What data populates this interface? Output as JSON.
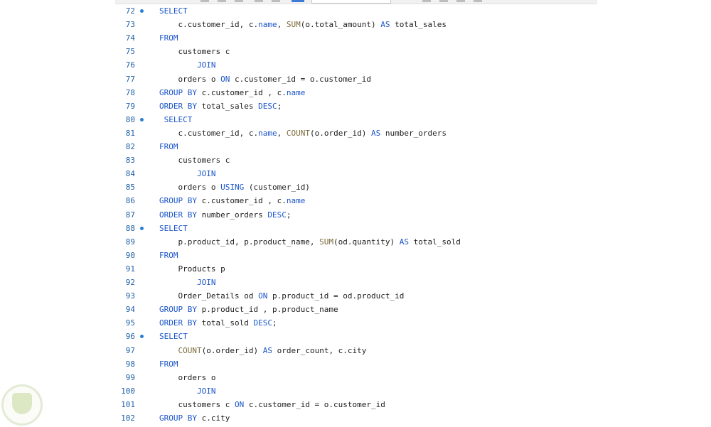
{
  "editor": {
    "lines": [
      {
        "num": "72",
        "fold": true,
        "tokens": [
          {
            "t": "SELECT",
            "k": "kw"
          }
        ]
      },
      {
        "num": "73",
        "fold": false,
        "tokens": [
          {
            "t": "    c.customer_id, c.",
            "k": "tx"
          },
          {
            "t": "name",
            "k": "kw"
          },
          {
            "t": ", ",
            "k": "tx"
          },
          {
            "t": "SUM",
            "k": "fn"
          },
          {
            "t": "(o.total_amount) ",
            "k": "tx"
          },
          {
            "t": "AS",
            "k": "kw"
          },
          {
            "t": " total_sales",
            "k": "tx"
          }
        ]
      },
      {
        "num": "74",
        "fold": false,
        "tokens": [
          {
            "t": "FROM",
            "k": "kw"
          }
        ]
      },
      {
        "num": "75",
        "fold": false,
        "tokens": [
          {
            "t": "    customers c",
            "k": "tx"
          }
        ]
      },
      {
        "num": "76",
        "fold": false,
        "tokens": [
          {
            "t": "        ",
            "k": "tx"
          },
          {
            "t": "JOIN",
            "k": "kw"
          }
        ]
      },
      {
        "num": "77",
        "fold": false,
        "tokens": [
          {
            "t": "    orders o ",
            "k": "tx"
          },
          {
            "t": "ON",
            "k": "kw"
          },
          {
            "t": " c.customer_id = o.customer_id",
            "k": "tx"
          }
        ]
      },
      {
        "num": "78",
        "fold": false,
        "tokens": [
          {
            "t": "GROUP BY",
            "k": "kw"
          },
          {
            "t": " c.customer_id , c.",
            "k": "tx"
          },
          {
            "t": "name",
            "k": "kw"
          }
        ]
      },
      {
        "num": "79",
        "fold": false,
        "tokens": [
          {
            "t": "ORDER BY",
            "k": "kw"
          },
          {
            "t": " total_sales ",
            "k": "tx"
          },
          {
            "t": "DESC",
            "k": "kw"
          },
          {
            "t": ";",
            "k": "tx"
          }
        ]
      },
      {
        "num": "80",
        "fold": true,
        "tokens": [
          {
            "t": " SELECT",
            "k": "kw"
          }
        ]
      },
      {
        "num": "81",
        "fold": false,
        "tokens": [
          {
            "t": "    c.customer_id, c.",
            "k": "tx"
          },
          {
            "t": "name",
            "k": "kw"
          },
          {
            "t": ", ",
            "k": "tx"
          },
          {
            "t": "COUNT",
            "k": "fn"
          },
          {
            "t": "(o.order_id) ",
            "k": "tx"
          },
          {
            "t": "AS",
            "k": "kw"
          },
          {
            "t": " number_orders",
            "k": "tx"
          }
        ]
      },
      {
        "num": "82",
        "fold": false,
        "tokens": [
          {
            "t": "FROM",
            "k": "kw"
          }
        ]
      },
      {
        "num": "83",
        "fold": false,
        "tokens": [
          {
            "t": "    customers c",
            "k": "tx"
          }
        ]
      },
      {
        "num": "84",
        "fold": false,
        "tokens": [
          {
            "t": "        ",
            "k": "tx"
          },
          {
            "t": "JOIN",
            "k": "kw"
          }
        ]
      },
      {
        "num": "85",
        "fold": false,
        "tokens": [
          {
            "t": "    orders o ",
            "k": "tx"
          },
          {
            "t": "USING",
            "k": "kw"
          },
          {
            "t": " (customer_id)",
            "k": "tx"
          }
        ]
      },
      {
        "num": "86",
        "fold": false,
        "tokens": [
          {
            "t": "GROUP BY",
            "k": "kw"
          },
          {
            "t": " c.customer_id , c.",
            "k": "tx"
          },
          {
            "t": "name",
            "k": "kw"
          }
        ]
      },
      {
        "num": "87",
        "fold": false,
        "tokens": [
          {
            "t": "ORDER BY",
            "k": "kw"
          },
          {
            "t": " number_orders ",
            "k": "tx"
          },
          {
            "t": "DESC",
            "k": "kw"
          },
          {
            "t": ";",
            "k": "tx"
          }
        ]
      },
      {
        "num": "88",
        "fold": true,
        "tokens": [
          {
            "t": "SELECT",
            "k": "kw"
          }
        ]
      },
      {
        "num": "89",
        "fold": false,
        "tokens": [
          {
            "t": "    p.product_id, p.product_name, ",
            "k": "tx"
          },
          {
            "t": "SUM",
            "k": "fn"
          },
          {
            "t": "(od.quantity) ",
            "k": "tx"
          },
          {
            "t": "AS",
            "k": "kw"
          },
          {
            "t": " total_sold",
            "k": "tx"
          }
        ]
      },
      {
        "num": "90",
        "fold": false,
        "tokens": [
          {
            "t": "FROM",
            "k": "kw"
          }
        ]
      },
      {
        "num": "91",
        "fold": false,
        "tokens": [
          {
            "t": "    Products p",
            "k": "tx"
          }
        ]
      },
      {
        "num": "92",
        "fold": false,
        "tokens": [
          {
            "t": "        ",
            "k": "tx"
          },
          {
            "t": "JOIN",
            "k": "kw"
          }
        ]
      },
      {
        "num": "93",
        "fold": false,
        "tokens": [
          {
            "t": "    Order_Details od ",
            "k": "tx"
          },
          {
            "t": "ON",
            "k": "kw"
          },
          {
            "t": " p.product_id = od.product_id",
            "k": "tx"
          }
        ]
      },
      {
        "num": "94",
        "fold": false,
        "tokens": [
          {
            "t": "GROUP BY",
            "k": "kw"
          },
          {
            "t": " p.product_id , p.product_name",
            "k": "tx"
          }
        ]
      },
      {
        "num": "95",
        "fold": false,
        "tokens": [
          {
            "t": "ORDER BY",
            "k": "kw"
          },
          {
            "t": " total_sold ",
            "k": "tx"
          },
          {
            "t": "DESC",
            "k": "kw"
          },
          {
            "t": ";",
            "k": "tx"
          }
        ]
      },
      {
        "num": "96",
        "fold": true,
        "tokens": [
          {
            "t": "SELECT",
            "k": "kw"
          }
        ]
      },
      {
        "num": "97",
        "fold": false,
        "tokens": [
          {
            "t": "    ",
            "k": "tx"
          },
          {
            "t": "COUNT",
            "k": "fn"
          },
          {
            "t": "(o.order_id) ",
            "k": "tx"
          },
          {
            "t": "AS",
            "k": "kw"
          },
          {
            "t": " order_count, c.city",
            "k": "tx"
          }
        ]
      },
      {
        "num": "98",
        "fold": false,
        "tokens": [
          {
            "t": "FROM",
            "k": "kw"
          }
        ]
      },
      {
        "num": "99",
        "fold": false,
        "tokens": [
          {
            "t": "    orders o",
            "k": "tx"
          }
        ]
      },
      {
        "num": "100",
        "fold": false,
        "tokens": [
          {
            "t": "        ",
            "k": "tx"
          },
          {
            "t": "JOIN",
            "k": "kw"
          }
        ]
      },
      {
        "num": "101",
        "fold": false,
        "tokens": [
          {
            "t": "    customers c ",
            "k": "tx"
          },
          {
            "t": "ON",
            "k": "kw"
          },
          {
            "t": " c.customer_id = o.customer_id",
            "k": "tx"
          }
        ]
      },
      {
        "num": "102",
        "fold": false,
        "tokens": [
          {
            "t": "GROUP BY",
            "k": "kw"
          },
          {
            "t": " c.city",
            "k": "tx"
          }
        ]
      }
    ]
  },
  "colors": {
    "keyword": "#1b55c9",
    "function": "#7a6a3a",
    "text": "#1e1e1e",
    "line_number": "#1f5fa8",
    "fold_marker": "#2a7fd4"
  }
}
